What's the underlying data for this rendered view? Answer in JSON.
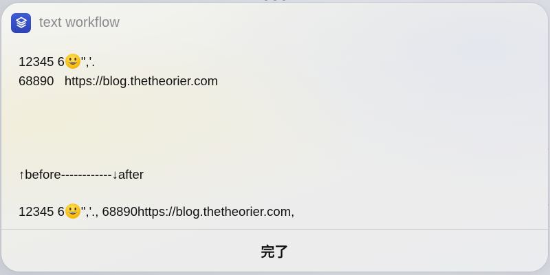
{
  "app": {
    "title": "text workflow",
    "icon": "shortcuts-app-icon"
  },
  "content": {
    "line1_prefix": "12345 6",
    "line1_suffix": "\",'.",
    "line2": "68890   https://blog.thetheorier.com",
    "separator": "↑before------------↓after",
    "line4_prefix": "12345 6",
    "line4_suffix": "\",'., 68890https://blog.thetheorier.com,"
  },
  "actions": {
    "done_label": "完了"
  },
  "colors": {
    "accent": "#3451c6",
    "title_gray": "#8a8a8e",
    "divider": "#cfcfd2"
  }
}
